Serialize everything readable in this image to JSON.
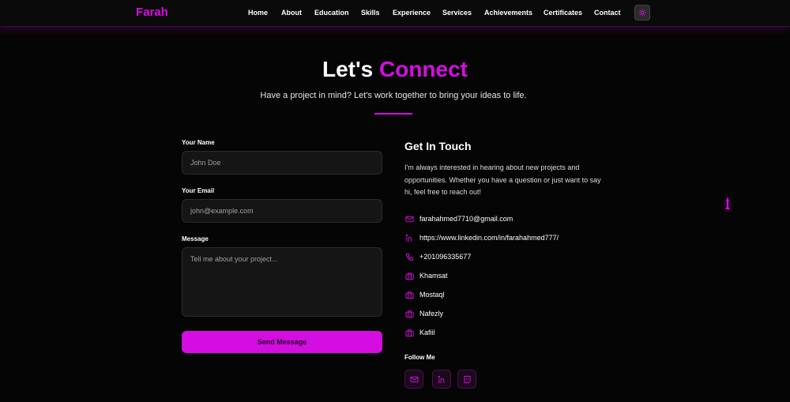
{
  "brand": "Farah",
  "nav": {
    "links": [
      "Home",
      "About",
      "Education",
      "Skills",
      "Experience",
      "Services",
      "Achievements",
      "Certificates",
      "Contact"
    ]
  },
  "theme_toggle_icon": "sun-icon",
  "header": {
    "title_part1": "Let's",
    "title_part2": "Connect",
    "subtitle": "Have a project in mind? Let's work together to bring your ideas to life."
  },
  "form": {
    "name_label": "Your Name",
    "name_placeholder": "John Doe",
    "email_label": "Your Email",
    "email_placeholder": "john@example.com",
    "message_label": "Message",
    "message_placeholder": "Tell me about your project...",
    "submit_label": "Send Message"
  },
  "contact": {
    "title": "Get In Touch",
    "description": "I'm always interested in hearing about new projects and opportunities. Whether you have a question or just want to say hi, feel free to reach out!",
    "items": [
      {
        "icon": "mail-icon",
        "text": "farahahmed7710@gmail.com"
      },
      {
        "icon": "linkedin-icon",
        "text": "https://www.linkedin.com/in/farahahmed777/"
      },
      {
        "icon": "phone-icon",
        "text": "+201096335677"
      },
      {
        "icon": "briefcase-icon",
        "text": "Khamsat"
      },
      {
        "icon": "briefcase-icon",
        "text": "Mostaql"
      },
      {
        "icon": "briefcase-icon",
        "text": "Nafezly"
      },
      {
        "icon": "briefcase-icon",
        "text": "Kafiil"
      }
    ],
    "follow_label": "Follow Me",
    "social": [
      "mail-icon",
      "linkedin-icon",
      "discord-icon"
    ]
  },
  "colors": {
    "accent": "#d40ee0",
    "background": "#050505",
    "input_bg": "#151515"
  }
}
